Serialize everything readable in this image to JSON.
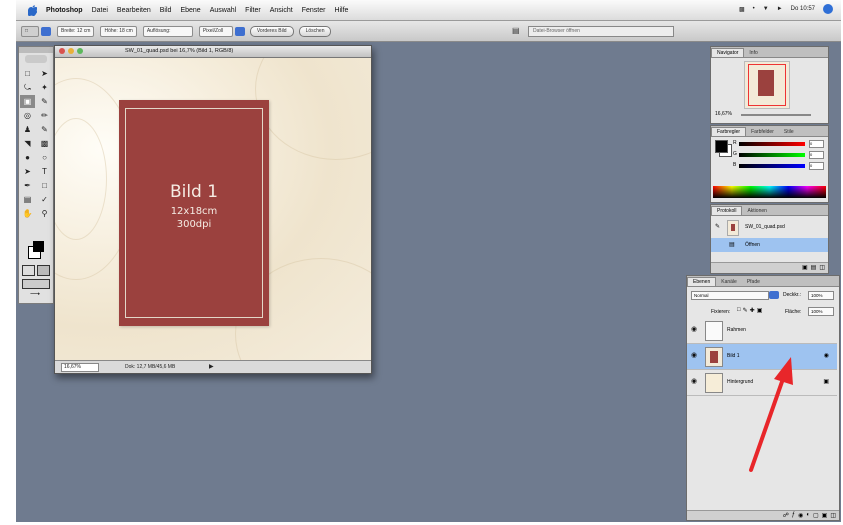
{
  "menubar": {
    "items": [
      "Photoshop",
      "Datei",
      "Bearbeiten",
      "Bild",
      "Ebene",
      "Auswahl",
      "Filter",
      "Ansicht",
      "Fenster",
      "Hilfe"
    ],
    "clock": "Do 10:57"
  },
  "options": {
    "breite_label": "Breite:",
    "hoehe_label": "Höhe:",
    "aufloesung_label": "Auflösung:",
    "pixel_label": "Pixel/Zoll",
    "vorderes_bild_btn": "Vorderes Bild",
    "loeschen_btn": "Löschen",
    "search_placeholder": "Datei-Browser öffnen"
  },
  "document": {
    "title": "SW_01_quad.psd bei 16,7% (Bild 1, RGB/8)",
    "zoom": "16,67%",
    "status": "Dok: 12,7 MB/45,6 MB",
    "card": {
      "title": "Bild 1",
      "size": "12x18cm",
      "dpi": "300dpi"
    }
  },
  "navigator": {
    "tabs": [
      "Navigator",
      "Info"
    ],
    "zoom": "16,67%"
  },
  "color": {
    "tabs": [
      "Farbregler",
      "Farbfelder",
      "Stile"
    ],
    "channels": [
      {
        "label": "R",
        "value": "0"
      },
      {
        "label": "G",
        "value": "0"
      },
      {
        "label": "B",
        "value": "0"
      }
    ]
  },
  "history": {
    "tabs": [
      "Protokoll",
      "Aktionen"
    ],
    "items": [
      "SW_01_quad.psd",
      "Öffnen"
    ]
  },
  "layers": {
    "tabs": [
      "Ebenen",
      "Kanäle",
      "Pfade"
    ],
    "blend_mode": "Normal",
    "opacity_label": "Deckkr.:",
    "opacity": "100%",
    "fixieren_label": "Fixieren:",
    "flaeche_label": "Fläche:",
    "flaeche": "100%",
    "rows": [
      {
        "name": "Rahmen"
      },
      {
        "name": "Bild 1"
      },
      {
        "name": "Hintergrund"
      }
    ]
  },
  "colors": {
    "desktop": "#6f7b8f",
    "card": "#9b413e",
    "selection": "#9ec3f0",
    "arrow": "#e8262a"
  }
}
